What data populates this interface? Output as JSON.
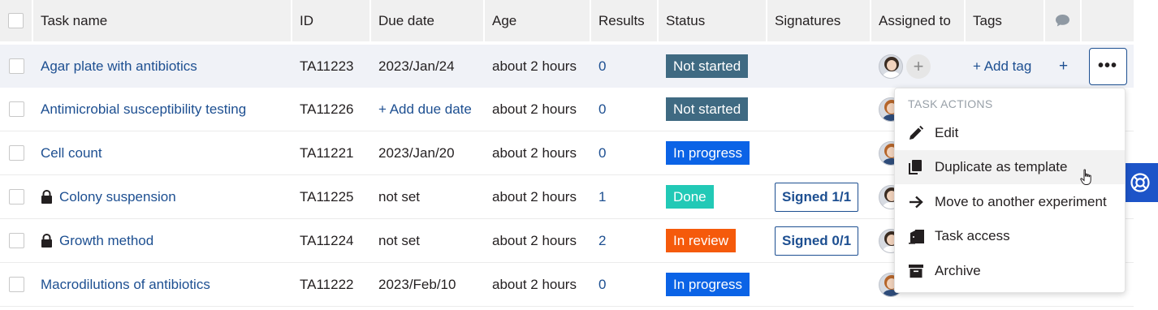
{
  "table": {
    "columns": {
      "task_name": "Task name",
      "id": "ID",
      "due_date": "Due date",
      "age": "Age",
      "results": "Results",
      "status": "Status",
      "signatures": "Signatures",
      "assigned_to": "Assigned to",
      "tags": "Tags"
    },
    "rows": [
      {
        "name": "Agar plate with antibiotics",
        "locked": false,
        "id": "TA11223",
        "due": "2023/Jan/24",
        "due_is_link": false,
        "age": "about 2 hours",
        "results": "0",
        "status": "Not started",
        "status_kind": "not-started",
        "signatures": "",
        "add_tag": "+ Add tag",
        "add_plus": "+"
      },
      {
        "name": "Antimicrobial susceptibility testing",
        "locked": false,
        "id": "TA11226",
        "due": "+ Add due date",
        "due_is_link": true,
        "age": "about 2 hours",
        "results": "0",
        "status": "Not started",
        "status_kind": "not-started",
        "signatures": ""
      },
      {
        "name": "Cell count",
        "locked": false,
        "id": "TA11221",
        "due": "2023/Jan/20",
        "due_is_link": false,
        "age": "about 2 hours",
        "results": "0",
        "status": "In progress",
        "status_kind": "in-progress",
        "signatures": ""
      },
      {
        "name": "Colony suspension",
        "locked": true,
        "id": "TA11225",
        "due": "not set",
        "due_is_link": false,
        "age": "about 2 hours",
        "results": "1",
        "status": "Done",
        "status_kind": "done",
        "signatures": "Signed 1/1"
      },
      {
        "name": "Growth method",
        "locked": true,
        "id": "TA11224",
        "due": "not set",
        "due_is_link": false,
        "age": "about 2 hours",
        "results": "2",
        "status": "In review",
        "status_kind": "in-review",
        "signatures": "Signed 0/1"
      },
      {
        "name": "Macrodilutions of antibiotics",
        "locked": false,
        "id": "TA11222",
        "due": "2023/Feb/10",
        "due_is_link": false,
        "age": "about 2 hours",
        "results": "0",
        "status": "In progress",
        "status_kind": "in-progress",
        "signatures": ""
      }
    ]
  },
  "row_menu": {
    "button_label": "•••"
  },
  "task_actions": {
    "title": "TASK ACTIONS",
    "items": [
      {
        "label": "Edit",
        "icon": "pencil-icon"
      },
      {
        "label": "Duplicate as template",
        "icon": "copy-icon"
      },
      {
        "label": "Move to another experiment",
        "icon": "arrow-right-icon"
      },
      {
        "label": "Task access",
        "icon": "door-access-icon"
      },
      {
        "label": "Archive",
        "icon": "archive-box-icon"
      }
    ]
  },
  "colors": {
    "link": "#1d4f91",
    "not_started": "#3f6a82",
    "in_progress": "#0b63e6",
    "done": "#22c9b6",
    "in_review": "#f55a0b",
    "help_tab": "#1d54c8",
    "header_bg": "#f0f0f0",
    "highlight_row": "#f0f2f7"
  }
}
